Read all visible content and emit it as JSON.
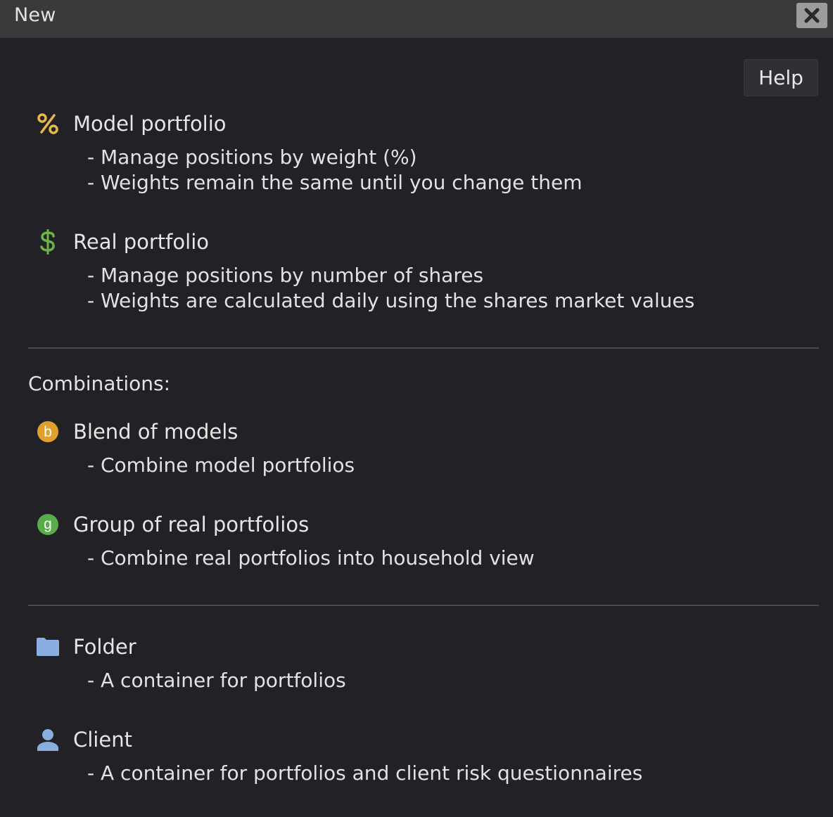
{
  "window": {
    "title": "New",
    "close_icon": "close-icon"
  },
  "help_label": "Help",
  "options": {
    "model": {
      "icon": "percent-icon",
      "icon_color": "#e8b84a",
      "title": "Model portfolio",
      "desc1": "- Manage positions by weight (%)",
      "desc2": "- Weights remain the same until you change them"
    },
    "real": {
      "icon": "dollar-icon",
      "icon_color": "#6db34b",
      "title": "Real portfolio",
      "desc1": "- Manage positions by number of shares",
      "desc2": "- Weights are calculated daily using the shares market values"
    },
    "blend": {
      "icon": "blend-b-icon",
      "icon_letter": "b",
      "icon_color": "#e0a02e",
      "title": "Blend of models",
      "desc1": "- Combine model portfolios"
    },
    "group": {
      "icon": "group-g-icon",
      "icon_letter": "g",
      "icon_color": "#5aab4a",
      "title": "Group of real portfolios",
      "desc1": "- Combine real portfolios into household view"
    },
    "folder": {
      "icon": "folder-icon",
      "icon_color": "#8aaee0",
      "title": "Folder",
      "desc1": "- A container for portfolios"
    },
    "client": {
      "icon": "person-icon",
      "icon_color": "#8aaee0",
      "title": "Client",
      "desc1": "- A container for portfolios and client risk questionnaires"
    }
  },
  "combinations_label": "Combinations:"
}
